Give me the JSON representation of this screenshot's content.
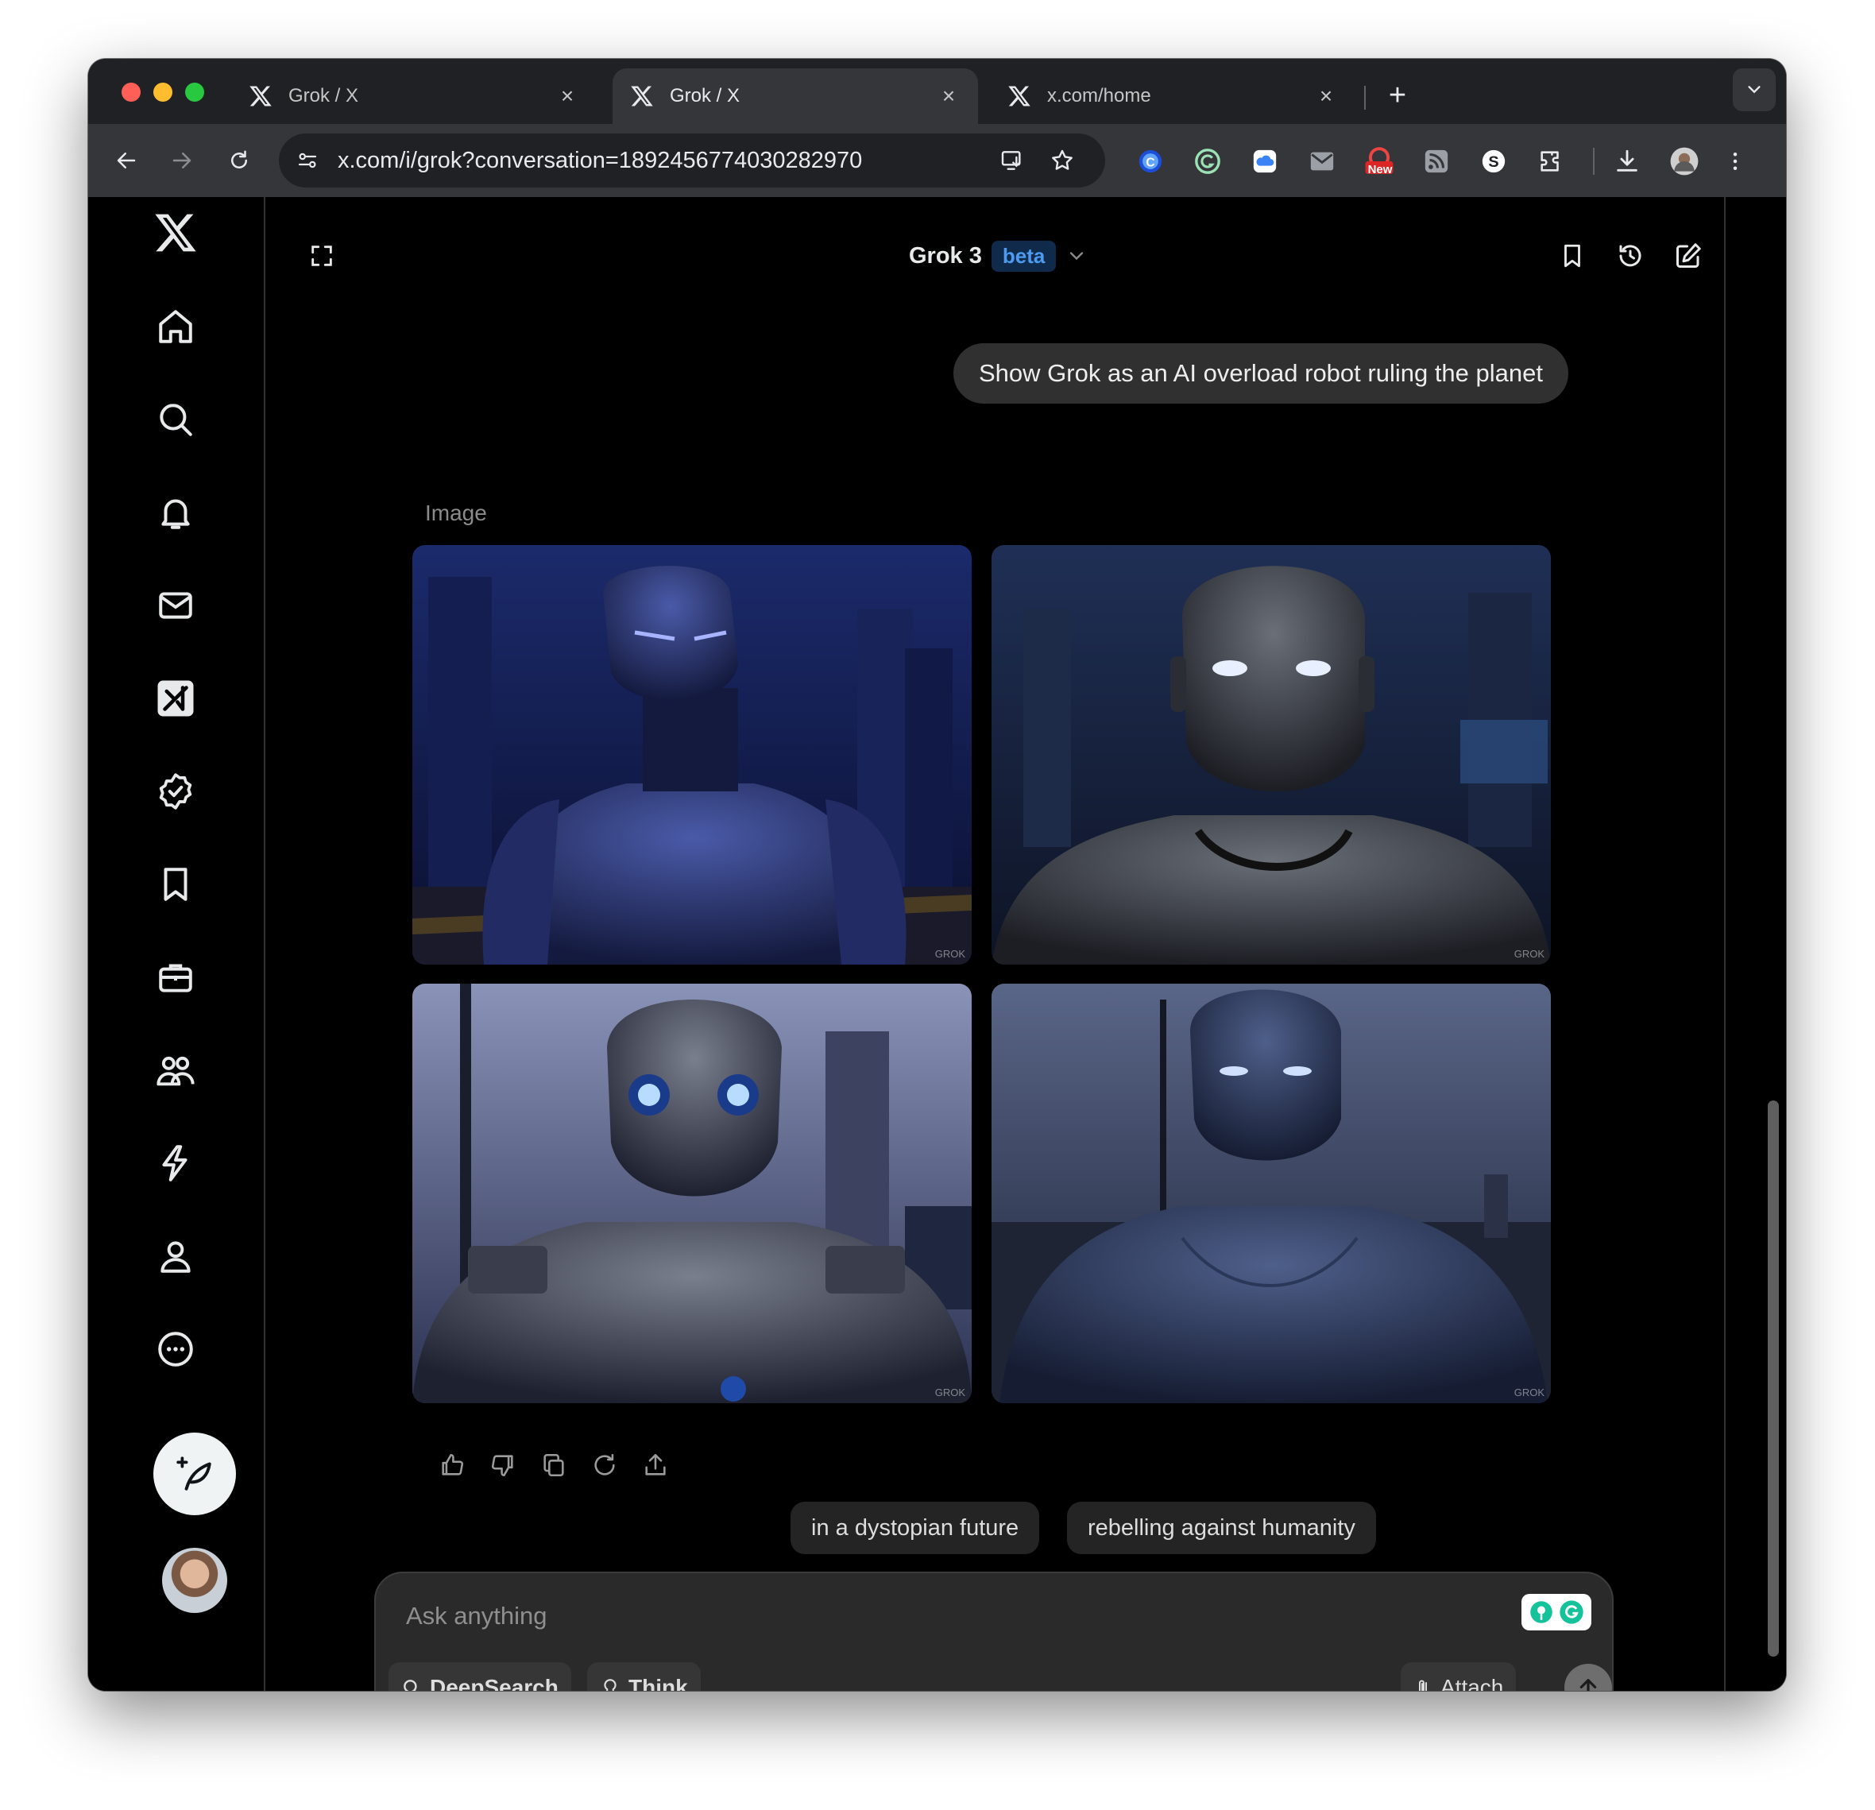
{
  "browser": {
    "tabs": [
      {
        "title": "Grok / X",
        "active": false
      },
      {
        "title": "Grok / X",
        "active": true
      },
      {
        "title": "x.com/home",
        "active": false
      }
    ],
    "url": "x.com/i/grok?conversation=1892456774030282970",
    "extension_badge": "New"
  },
  "header": {
    "model_name": "Grok 3",
    "model_badge": "beta"
  },
  "conversation": {
    "user_message": "Show Grok as an AI overload robot ruling the planet",
    "response_label": "Image",
    "image_watermark": "GROK",
    "images": [
      {
        "description": "robot-1"
      },
      {
        "description": "robot-2"
      },
      {
        "description": "robot-3"
      },
      {
        "description": "robot-4"
      }
    ],
    "suggestions": [
      "in a dystopian future",
      "rebelling against humanity"
    ]
  },
  "composer": {
    "placeholder": "Ask anything",
    "deepsearch_label": "DeepSearch",
    "think_label": "Think",
    "attach_label": "Attach"
  },
  "colors": {
    "beta_bg": "#0f2a4a",
    "beta_text": "#4d9bf0",
    "bubble_bg": "#303030"
  }
}
